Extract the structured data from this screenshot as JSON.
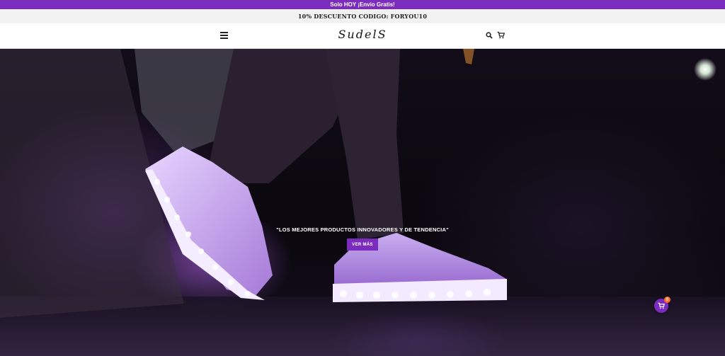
{
  "topbar": {
    "text": "Solo HOY ¡Envio Gratis!"
  },
  "promo": {
    "text": "10% DESCUENTO CODIGO: FORYOU10"
  },
  "header": {
    "logo": "SudelS",
    "menu_icon": "hamburger-menu-icon",
    "search_icon": "search-icon",
    "cart_icon": "cart-icon"
  },
  "hero": {
    "tagline": "\"LOS MEJORES PRODUCTOS INNOVADORES Y DE TENDENCIA\"",
    "cta_label": "VER MÁS"
  },
  "floating_cart": {
    "icon": "cart-icon",
    "badge": "0"
  },
  "colors": {
    "accent": "#7b2cbf",
    "badge": "#ff6a2a",
    "glow": "#c084fc"
  }
}
